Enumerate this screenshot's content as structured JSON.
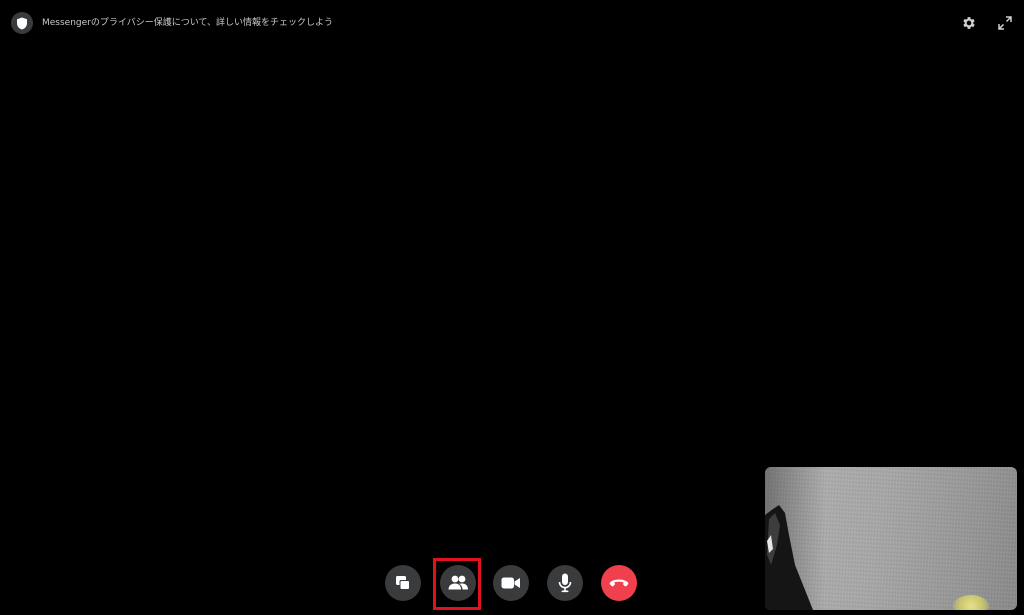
{
  "header": {
    "privacy_text": "Messengerのプライバシー保護について、詳しい情報をチェックしよう"
  },
  "icons": {
    "privacy": "shield-icon",
    "settings": "gear-icon",
    "fullscreen": "expand-icon",
    "screen_share": "screen-share-icon",
    "participants": "people-icon",
    "video": "video-camera-icon",
    "microphone": "microphone-icon",
    "end_call": "phone-hangup-icon"
  },
  "colors": {
    "background": "#000000",
    "button": "#3a3b3c",
    "end_call": "#f0404d",
    "highlight": "#e0121b"
  }
}
